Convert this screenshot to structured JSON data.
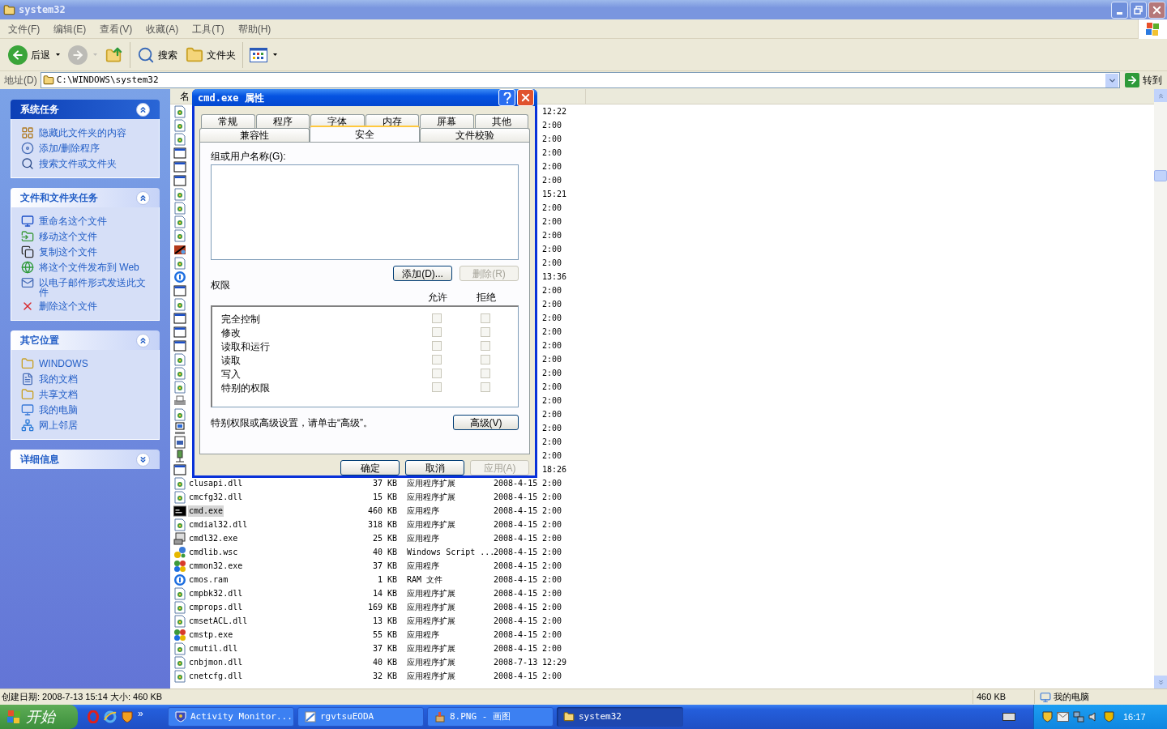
{
  "window": {
    "title": "system32"
  },
  "menu": [
    "文件(F)",
    "编辑(E)",
    "查看(V)",
    "收藏(A)",
    "工具(T)",
    "帮助(H)"
  ],
  "toolbar": [
    {
      "kind": "back",
      "label": "后退",
      "dropdown": true,
      "disabled": false,
      "separator_after": false
    },
    {
      "kind": "forward",
      "dropdown": true,
      "disabled": true,
      "separator_after": false
    },
    {
      "kind": "up",
      "dropdown": false,
      "disabled": false,
      "separator_after": true
    },
    {
      "kind": "search",
      "label": "搜索",
      "dropdown": false,
      "disabled": false,
      "separator_after": false
    },
    {
      "kind": "folders",
      "label": "文件夹",
      "dropdown": false,
      "disabled": false,
      "separator_after": true
    },
    {
      "kind": "views",
      "dropdown": true,
      "disabled": false,
      "separator_after": false
    }
  ],
  "address": {
    "label": "地址(D)",
    "value": "C:\\WINDOWS\\system32",
    "go": "转到"
  },
  "task_panes": [
    {
      "title": "系统任务",
      "special": true,
      "expanded": true,
      "items": [
        {
          "kind": "hide",
          "label": "隐藏此文件夹的内容"
        },
        {
          "kind": "addremove",
          "label": "添加/删除程序"
        },
        {
          "kind": "search",
          "label": "搜索文件或文件夹"
        }
      ]
    },
    {
      "title": "文件和文件夹任务",
      "special": false,
      "expanded": true,
      "items": [
        {
          "kind": "rename",
          "label": "重命名这个文件"
        },
        {
          "kind": "move",
          "label": "移动这个文件"
        },
        {
          "kind": "copy",
          "label": "复制这个文件"
        },
        {
          "kind": "publish",
          "label": "将这个文件发布到 Web"
        },
        {
          "kind": "email",
          "label": "以电子邮件形式发送此文件"
        },
        {
          "kind": "delete",
          "label": "删除这个文件"
        }
      ]
    },
    {
      "title": "其它位置",
      "special": false,
      "expanded": true,
      "items": [
        {
          "kind": "folder",
          "label": "WINDOWS"
        },
        {
          "kind": "documents",
          "label": "我的文档"
        },
        {
          "kind": "folder",
          "label": "共享文档"
        },
        {
          "kind": "computer",
          "label": "我的电脑"
        },
        {
          "kind": "network",
          "label": "网上邻居"
        }
      ]
    },
    {
      "title": "详细信息",
      "special": false,
      "expanded": false
    }
  ],
  "file_list": {
    "name_header": "名",
    "rows": [
      {
        "kind": "dll",
        "time": "12:22",
        "selected": false
      },
      {
        "kind": "dll",
        "time": "2:00",
        "selected": false
      },
      {
        "kind": "dll",
        "time": "2:00",
        "selected": false
      },
      {
        "kind": "window",
        "time": "2:00",
        "selected": false
      },
      {
        "kind": "window",
        "time": "2:00",
        "selected": false
      },
      {
        "kind": "window",
        "time": "2:00",
        "selected": false
      },
      {
        "kind": "dll",
        "time": "15:21",
        "selected": false
      },
      {
        "kind": "dll",
        "time": "2:00",
        "selected": false
      },
      {
        "kind": "dll",
        "time": "2:00",
        "selected": false
      },
      {
        "kind": "dll",
        "time": "2:00",
        "selected": false
      },
      {
        "kind": "tool",
        "time": "2:00",
        "selected": false
      },
      {
        "kind": "dll",
        "time": "2:00",
        "selected": false
      },
      {
        "kind": "circle",
        "time": "13:36",
        "selected": false
      },
      {
        "kind": "window",
        "time": "2:00",
        "selected": false
      },
      {
        "kind": "dll",
        "time": "2:00",
        "selected": false
      },
      {
        "kind": "window",
        "time": "2:00",
        "selected": false
      },
      {
        "kind": "window",
        "time": "2:00",
        "selected": false
      },
      {
        "kind": "window",
        "time": "2:00",
        "selected": false
      },
      {
        "kind": "dll",
        "time": "2:00",
        "selected": false
      },
      {
        "kind": "dll",
        "time": "2:00",
        "selected": false
      },
      {
        "kind": "dll",
        "time": "2:00",
        "selected": false
      },
      {
        "kind": "printer",
        "time": "2:00",
        "selected": false
      },
      {
        "kind": "dll",
        "time": "2:00",
        "selected": false
      },
      {
        "kind": "computer",
        "time": "2:00",
        "selected": false
      },
      {
        "kind": "doc",
        "time": "2:00",
        "selected": false
      },
      {
        "kind": "plug",
        "time": "2:00",
        "selected": false
      },
      {
        "kind": "window",
        "time": "18:26",
        "selected": false
      },
      {
        "kind": "dll",
        "name": "clusapi.dll",
        "size": "37 KB",
        "type": "应用程序扩展",
        "date": "2008-4-15",
        "time": "2:00",
        "selected": false
      },
      {
        "kind": "dll",
        "name": "cmcfg32.dll",
        "size": "15 KB",
        "type": "应用程序扩展",
        "date": "2008-4-15",
        "time": "2:00",
        "selected": false
      },
      {
        "kind": "cmd",
        "name": "cmd.exe",
        "size": "460 KB",
        "type": "应用程序",
        "date": "2008-4-15",
        "time": "2:00",
        "selected": true
      },
      {
        "kind": "dll",
        "name": "cmdial32.dll",
        "size": "318 KB",
        "type": "应用程序扩展",
        "date": "2008-4-15",
        "time": "2:00",
        "selected": false
      },
      {
        "kind": "setup",
        "name": "cmdl32.exe",
        "size": "25 KB",
        "type": "应用程序",
        "date": "2008-4-15",
        "time": "2:00",
        "selected": false
      },
      {
        "kind": "script",
        "name": "cmdlib.wsc",
        "size": "40 KB",
        "type": "Windows Script ...",
        "date": "2008-4-15",
        "time": "2:00",
        "selected": false
      },
      {
        "kind": "multi",
        "name": "cmmon32.exe",
        "size": "37 KB",
        "type": "应用程序",
        "date": "2008-4-15",
        "time": "2:00",
        "selected": false
      },
      {
        "kind": "circle",
        "name": "cmos.ram",
        "size": "1 KB",
        "type": "RAM 文件",
        "date": "2008-4-15",
        "time": "2:00",
        "selected": false
      },
      {
        "kind": "dll",
        "name": "cmpbk32.dll",
        "size": "14 KB",
        "type": "应用程序扩展",
        "date": "2008-4-15",
        "time": "2:00",
        "selected": false
      },
      {
        "kind": "dll",
        "name": "cmprops.dll",
        "size": "169 KB",
        "type": "应用程序扩展",
        "date": "2008-4-15",
        "time": "2:00",
        "selected": false
      },
      {
        "kind": "dll",
        "name": "cmsetACL.dll",
        "size": "13 KB",
        "type": "应用程序扩展",
        "date": "2008-4-15",
        "time": "2:00",
        "selected": false
      },
      {
        "kind": "multi",
        "name": "cmstp.exe",
        "size": "55 KB",
        "type": "应用程序",
        "date": "2008-4-15",
        "time": "2:00",
        "selected": false
      },
      {
        "kind": "dll",
        "name": "cmutil.dll",
        "size": "37 KB",
        "type": "应用程序扩展",
        "date": "2008-4-15",
        "time": "2:00",
        "selected": false
      },
      {
        "kind": "dll",
        "name": "cnbjmon.dll",
        "size": "40 KB",
        "type": "应用程序扩展",
        "date": "2008-7-13",
        "time": "12:29",
        "selected": false
      },
      {
        "kind": "dll",
        "name": "cnetcfg.dll",
        "size": "32 KB",
        "type": "应用程序扩展",
        "date": "2008-4-15",
        "time": "2:00",
        "selected": false
      }
    ]
  },
  "dialog": {
    "title": "cmd.exe 属性",
    "tab_rows": [
      [
        {
          "label": "常规",
          "selected": false
        },
        {
          "label": "程序",
          "selected": false
        },
        {
          "label": "字体",
          "selected": false
        },
        {
          "label": "内存",
          "selected": false
        },
        {
          "label": "屏幕",
          "selected": false
        },
        {
          "label": "其他",
          "selected": false
        }
      ],
      [
        {
          "label": "兼容性",
          "selected": false
        },
        {
          "label": "安全",
          "selected": true
        },
        {
          "label": "文件校验",
          "selected": false
        }
      ]
    ],
    "users_label": "组或用户名称(G):",
    "add_button": {
      "label": "添加(D)...",
      "disabled": false
    },
    "remove_button": {
      "label": "删除(R)",
      "disabled": true
    },
    "permissions_label": "权限",
    "allow_header": "允许",
    "deny_header": "拒绝",
    "permissions": [
      {
        "label": "完全控制",
        "allow": false,
        "deny": false
      },
      {
        "label": "修改",
        "allow": false,
        "deny": false
      },
      {
        "label": "读取和运行",
        "allow": false,
        "deny": false
      },
      {
        "label": "读取",
        "allow": false,
        "deny": false
      },
      {
        "label": "写入",
        "allow": false,
        "deny": false
      },
      {
        "label": "特别的权限",
        "allow": false,
        "deny": false
      }
    ],
    "advanced_hint": "特别权限或高级设置，请单击“高级”。",
    "advanced_button": {
      "label": "高级(V)",
      "disabled": false
    },
    "buttons": [
      {
        "label": "确定",
        "disabled": false
      },
      {
        "label": "取消",
        "disabled": false
      },
      {
        "label": "应用(A)",
        "disabled": true
      }
    ]
  },
  "status_bar": {
    "details": "创建日期: 2008-7-13 15:14 大小: 460 KB",
    "size": "460 KB",
    "zone": "我的电脑"
  },
  "taskbar": {
    "start": "开始",
    "more": "»",
    "tasks": [
      {
        "kind": "monitor",
        "label": "Activity Monitor...",
        "selected": false
      },
      {
        "kind": "image",
        "label": "rgvtsuEODA",
        "selected": false
      },
      {
        "kind": "paint",
        "label": "8.PNG - 画图",
        "selected": false
      },
      {
        "kind": "folder",
        "label": "system32",
        "selected": true
      }
    ],
    "clock": "16:17"
  }
}
